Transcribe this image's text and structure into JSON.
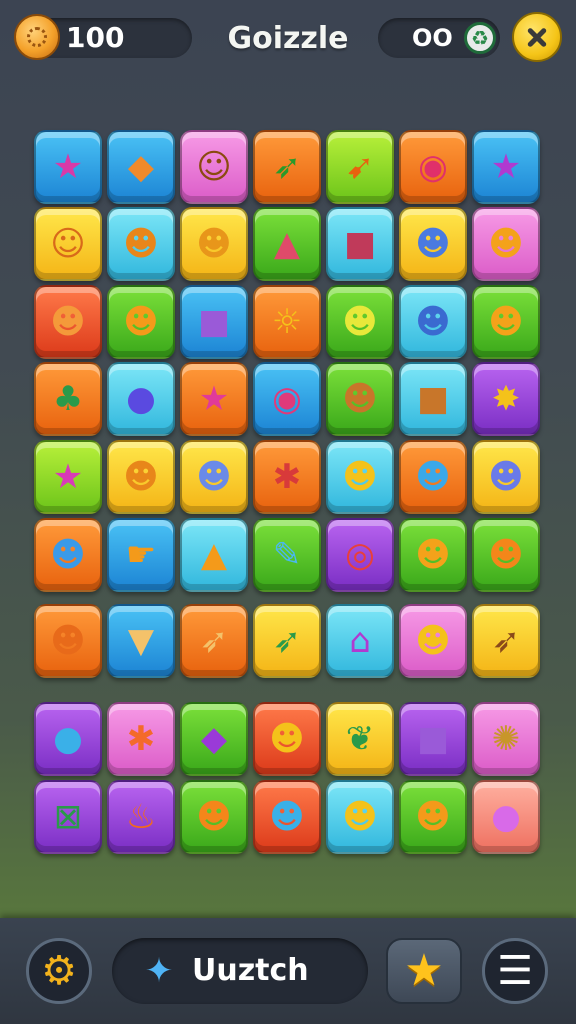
{
  "header": {
    "coins": "100",
    "title": "Goizzle",
    "score": "OO",
    "coin_icon": "coin-icon",
    "score_icon": "recycle-icon",
    "close_icon": "close-icon"
  },
  "board": {
    "rows": [
      [
        {
          "color": "blue",
          "icon": "star-icon",
          "glyph": "★",
          "ink": "#d83aa8"
        },
        {
          "color": "blue",
          "icon": "kite-icon",
          "glyph": "◆",
          "ink": "#f08a2a"
        },
        {
          "color": "pink",
          "icon": "bear-face-icon",
          "glyph": "☺",
          "ink": "#8a4a10"
        },
        {
          "color": "orange",
          "icon": "arrow-icon",
          "glyph": "➶",
          "ink": "#2a9a2a"
        },
        {
          "color": "lime",
          "icon": "carrot-icon",
          "glyph": "➹",
          "ink": "#e8620e"
        },
        {
          "color": "orange",
          "icon": "donut-icon",
          "glyph": "◉",
          "ink": "#e0306a"
        },
        {
          "color": "blue",
          "icon": "star-icon",
          "glyph": "★",
          "ink": "#b03ad0"
        }
      ],
      [
        {
          "color": "yellow",
          "icon": "cat-face-icon",
          "glyph": "☺",
          "ink": "#d86a1a"
        },
        {
          "color": "cyan",
          "icon": "bear-face-icon",
          "glyph": "☻",
          "ink": "#e8861a"
        },
        {
          "color": "yellow",
          "icon": "bear-face-icon",
          "glyph": "☻",
          "ink": "#e8961a"
        },
        {
          "color": "green",
          "icon": "ghost-icon",
          "glyph": "▲",
          "ink": "#e04a6a"
        },
        {
          "color": "cyan",
          "icon": "box-icon",
          "glyph": "■",
          "ink": "#c03a5a"
        },
        {
          "color": "yellow",
          "icon": "blob-face-icon",
          "glyph": "☻",
          "ink": "#4a7ae0"
        },
        {
          "color": "pink",
          "icon": "monster-face-icon",
          "glyph": "☻",
          "ink": "#f4a21a"
        }
      ],
      [
        {
          "color": "red",
          "icon": "lion-face-icon",
          "glyph": "☻",
          "ink": "#f49a3a"
        },
        {
          "color": "green",
          "icon": "pumpkin-icon",
          "glyph": "☻",
          "ink": "#f49a1a"
        },
        {
          "color": "blue",
          "icon": "box-icon",
          "glyph": "■",
          "ink": "#9a5ad8"
        },
        {
          "color": "orange",
          "icon": "sun-face-icon",
          "glyph": "☼",
          "ink": "#f4c21a"
        },
        {
          "color": "green",
          "icon": "apple-face-icon",
          "glyph": "☻",
          "ink": "#e8e83a"
        },
        {
          "color": "cyan",
          "icon": "jelly-icon",
          "glyph": "☻",
          "ink": "#3a6ad0"
        },
        {
          "color": "green",
          "icon": "lion-face-icon",
          "glyph": "☻",
          "ink": "#f4a21a"
        }
      ],
      [
        {
          "color": "orange",
          "icon": "ice-cream-icon",
          "glyph": "♣",
          "ink": "#2a9a4a"
        },
        {
          "color": "cyan",
          "icon": "capsule-icon",
          "glyph": "●",
          "ink": "#5a4ae0"
        },
        {
          "color": "orange",
          "icon": "star-icon",
          "glyph": "★",
          "ink": "#e03a9a"
        },
        {
          "color": "blue",
          "icon": "donut-icon",
          "glyph": "◉",
          "ink": "#e03a7a"
        },
        {
          "color": "green",
          "icon": "cookie-face-icon",
          "glyph": "☻",
          "ink": "#c8762a"
        },
        {
          "color": "cyan",
          "icon": "gift-box-icon",
          "glyph": "■",
          "ink": "#c8762a"
        },
        {
          "color": "purple",
          "icon": "star-face-icon",
          "glyph": "✸",
          "ink": "#f4c21a"
        }
      ],
      [
        {
          "color": "lime",
          "icon": "star-icon",
          "glyph": "★",
          "ink": "#d83ab8"
        },
        {
          "color": "yellow",
          "icon": "pumpkin-icon",
          "glyph": "☻",
          "ink": "#e8861a"
        },
        {
          "color": "yellow",
          "icon": "cat-face-icon",
          "glyph": "☻",
          "ink": "#6a8ae8"
        },
        {
          "color": "orange",
          "icon": "crab-icon",
          "glyph": "✱",
          "ink": "#d83a3a"
        },
        {
          "color": "cyan",
          "icon": "fox-face-icon",
          "glyph": "☻",
          "ink": "#f4c21a"
        },
        {
          "color": "orange",
          "icon": "octopus-icon",
          "glyph": "☻",
          "ink": "#3aa8e8"
        },
        {
          "color": "yellow",
          "icon": "blob-face-icon",
          "glyph": "☻",
          "ink": "#6a7ae8"
        }
      ],
      [
        {
          "color": "orange",
          "icon": "jelly-icon",
          "glyph": "☻",
          "ink": "#3a9ae8"
        },
        {
          "color": "blue",
          "icon": "fish-icon",
          "glyph": "☛",
          "ink": "#f49a1a"
        },
        {
          "color": "cyan",
          "icon": "flame-face-icon",
          "glyph": "▲",
          "ink": "#f49a1a"
        },
        {
          "color": "green",
          "icon": "paintbrush-icon",
          "glyph": "✎",
          "ink": "#4ab8f0"
        },
        {
          "color": "purple",
          "icon": "lollipop-icon",
          "glyph": "◎",
          "ink": "#e8403a"
        },
        {
          "color": "green",
          "icon": "cat-face-icon",
          "glyph": "☻",
          "ink": "#f4a21a"
        },
        {
          "color": "green",
          "icon": "pumpkin-icon",
          "glyph": "☻",
          "ink": "#f4861a"
        }
      ],
      [
        {
          "color": "orange",
          "icon": "pumpkin-icon",
          "glyph": "☻",
          "ink": "#e86a1a"
        },
        {
          "color": "blue",
          "icon": "ice-cream-cone-icon",
          "glyph": "▼",
          "ink": "#f4c26a"
        },
        {
          "color": "orange",
          "icon": "arrow-icon",
          "glyph": "➶",
          "ink": "#f4c26a"
        },
        {
          "color": "yellow",
          "icon": "arrow-icon",
          "glyph": "➶",
          "ink": "#2a9a4a"
        },
        {
          "color": "cyan",
          "icon": "keyhole-icon",
          "glyph": "⌂",
          "ink": "#b03ad0"
        },
        {
          "color": "pink",
          "icon": "bear-face-icon",
          "glyph": "☻",
          "ink": "#f4c21a"
        },
        {
          "color": "yellow",
          "icon": "arrow-icon",
          "glyph": "➶",
          "ink": "#8a4a1a"
        }
      ],
      [
        {
          "color": "purple",
          "icon": "shell-icon",
          "glyph": "●",
          "ink": "#3ab0e8"
        },
        {
          "color": "pink",
          "icon": "crab-icon",
          "glyph": "✱",
          "ink": "#f46a2a"
        },
        {
          "color": "green",
          "icon": "gem-icon",
          "glyph": "◆",
          "ink": "#9a3ad8"
        },
        {
          "color": "red",
          "icon": "bear-face-icon",
          "glyph": "☻",
          "ink": "#f4c21a"
        },
        {
          "color": "yellow",
          "icon": "leaf-icon",
          "glyph": "❦",
          "ink": "#2a9a4a"
        },
        {
          "color": "purple",
          "icon": "bag-icon",
          "glyph": "■",
          "ink": "#9a5ad8"
        },
        {
          "color": "pink",
          "icon": "sun-icon",
          "glyph": "✺",
          "ink": "#c8962a"
        }
      ],
      [
        {
          "color": "purple",
          "icon": "crate-icon",
          "glyph": "⊠",
          "ink": "#2a9a4a"
        },
        {
          "color": "purple",
          "icon": "cupcake-icon",
          "glyph": "♨",
          "ink": "#f46a1a"
        },
        {
          "color": "green",
          "icon": "pumpkin-icon",
          "glyph": "☻",
          "ink": "#f4861a"
        },
        {
          "color": "red",
          "icon": "ghost-icon",
          "glyph": "☻",
          "ink": "#3ab0e8"
        },
        {
          "color": "cyan",
          "icon": "bunny-face-icon",
          "glyph": "☻",
          "ink": "#f4c21a"
        },
        {
          "color": "green",
          "icon": "cat-face-icon",
          "glyph": "☻",
          "ink": "#f49a1a"
        },
        {
          "color": "salmon",
          "icon": "balloon-icon",
          "glyph": "●",
          "ink": "#d86ae8"
        }
      ]
    ]
  },
  "footer": {
    "settings_icon": "gear-icon",
    "switch_label": "Uuztch",
    "switch_icon": "candy-icon",
    "star_icon": "star-icon",
    "menu_icon": "menu-icon"
  }
}
